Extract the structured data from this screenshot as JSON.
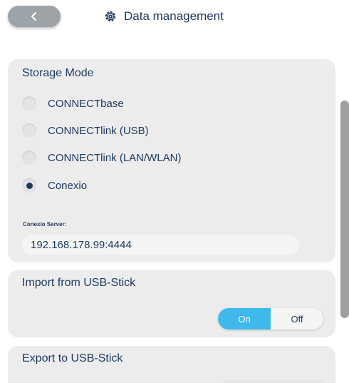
{
  "header": {
    "back_icon": "chevron-left-icon",
    "settings_icon": "gear-icon",
    "title": "Data management"
  },
  "storage": {
    "title": "Storage Mode",
    "options": [
      {
        "label": "CONNECTbase",
        "selected": false
      },
      {
        "label": "CONNECTlink (USB)",
        "selected": false
      },
      {
        "label": "CONNECTlink (LAN/WLAN)",
        "selected": false
      },
      {
        "label": "Conexio",
        "selected": true
      }
    ],
    "server_label": "Conexio Server:",
    "server_value": "192.168.178.99:4444"
  },
  "import": {
    "title": "Import from USB-Stick",
    "on_label": "On",
    "off_label": "Off",
    "state": "On"
  },
  "export": {
    "title": "Export to USB-Stick"
  },
  "colors": {
    "accent": "#3fb8ec",
    "text": "#1d3a5c",
    "panel": "#ececed",
    "back_button": "#9ea3a8"
  }
}
